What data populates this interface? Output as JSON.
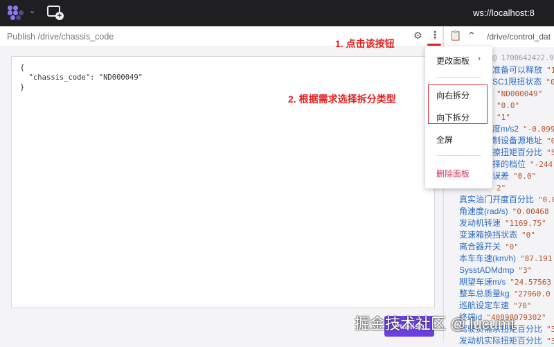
{
  "topbar": {
    "ws_url": "ws://localhost:8"
  },
  "left_panel": {
    "title": "Publish /drive/chassis_code",
    "editor_text": "{\n  \"chassis_code\": \"ND000049\"\n}",
    "publish_label": "Publish"
  },
  "annotations": {
    "step1": "1. 点击该按钮",
    "step2": "2. 根据需求选择拆分类型"
  },
  "right_panel": {
    "path": "/drive/control_dat",
    "timestamp": "@ 1700642422.9",
    "lines": [
      {
        "k": "准备可以释放",
        "v": "\"1",
        "under": true
      },
      {
        "k": "SC1限扭状态",
        "v": "\"0",
        "under": true
      },
      {
        "k": "",
        "v": "\"ND000049\"",
        "under": true
      },
      {
        "k": "",
        "v": " \"0.0\"",
        "under": true
      },
      {
        "k": "",
        "v": "  \"1\"",
        "under": true
      },
      {
        "k": "度m/s2",
        "v": "\"-0.099",
        "under": true
      },
      {
        "k": "制设备源地址",
        "v": "\"0",
        "under": true
      },
      {
        "k": "擦扭矩百分比",
        "v": "\"5",
        "under": true
      },
      {
        "k": "择的档位",
        "v": "\"-244",
        "under": true
      },
      {
        "k": "误差",
        "v": "\"0.0\"",
        "under": true
      },
      {
        "k": "",
        "v": "2\"",
        "under": true
      },
      {
        "k": "真实油门开度百分比",
        "v": "\"0.0"
      },
      {
        "k": "角速度(rad/s)",
        "v": "\"0.00468"
      },
      {
        "k": "发动机转速",
        "v": "\"1169.75\""
      },
      {
        "k": "变速箱换挡状态",
        "v": "\"0\""
      },
      {
        "k": "离合器开关",
        "v": "\"0\""
      },
      {
        "k": "本车车速(km/h)",
        "v": "\"87.191"
      },
      {
        "k": "SysstADMdmp",
        "v": "\"3\""
      },
      {
        "k": "期望车速m/s",
        "v": "\"24.57563"
      },
      {
        "k": "整车总质量kg",
        "v": "\"27960.0"
      },
      {
        "k": "巡航设定车速",
        "v": "\"70\""
      },
      {
        "k": "终端id",
        "v": "\"40898079302\""
      },
      {
        "k": "驾驶员需求扭矩百分比",
        "v": "\"3"
      },
      {
        "k": "发动机实际扭矩百分比",
        "v": "\"3"
      }
    ]
  },
  "menu": {
    "change_panel": "更改面板",
    "split_right": "向右拆分",
    "split_down": "向下拆分",
    "fullscreen": "全屏",
    "delete_panel": "删除面板"
  },
  "watermark": "掘金技术社区 @ lucumt"
}
